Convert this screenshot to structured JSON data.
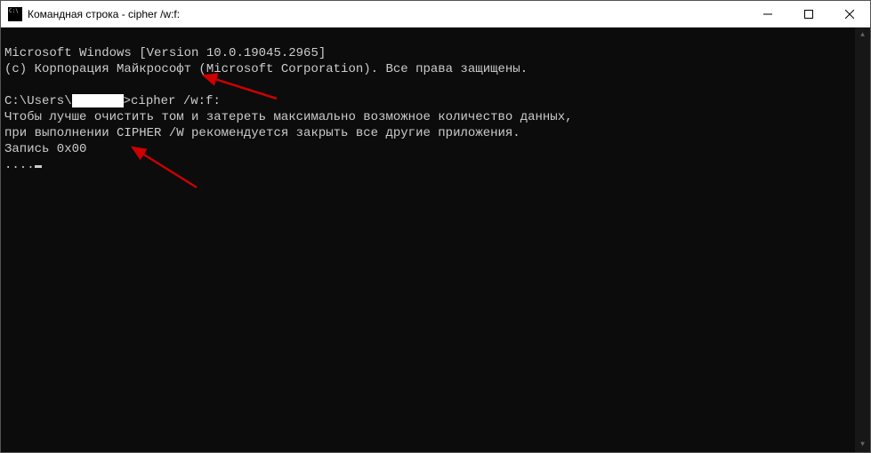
{
  "titlebar": {
    "title": "Командная строка - cipher  /w:f:"
  },
  "terminal": {
    "line1": "Microsoft Windows [Version 10.0.19045.2965]",
    "line2": "(c) Корпорация Майкрософт (Microsoft Corporation). Все права защищены.",
    "prompt_prefix": "C:\\Users\\",
    "prompt_suffix": ">cipher /w:f:",
    "line4": "Чтобы лучше очистить том и затереть максимально возможное количество данных,",
    "line5": "при выполнении CIPHER /W рекомендуется закрыть все другие приложения.",
    "line6": "Запись 0x00",
    "dots": "...."
  },
  "annotations": {
    "arrow_color": "#cc0000"
  }
}
